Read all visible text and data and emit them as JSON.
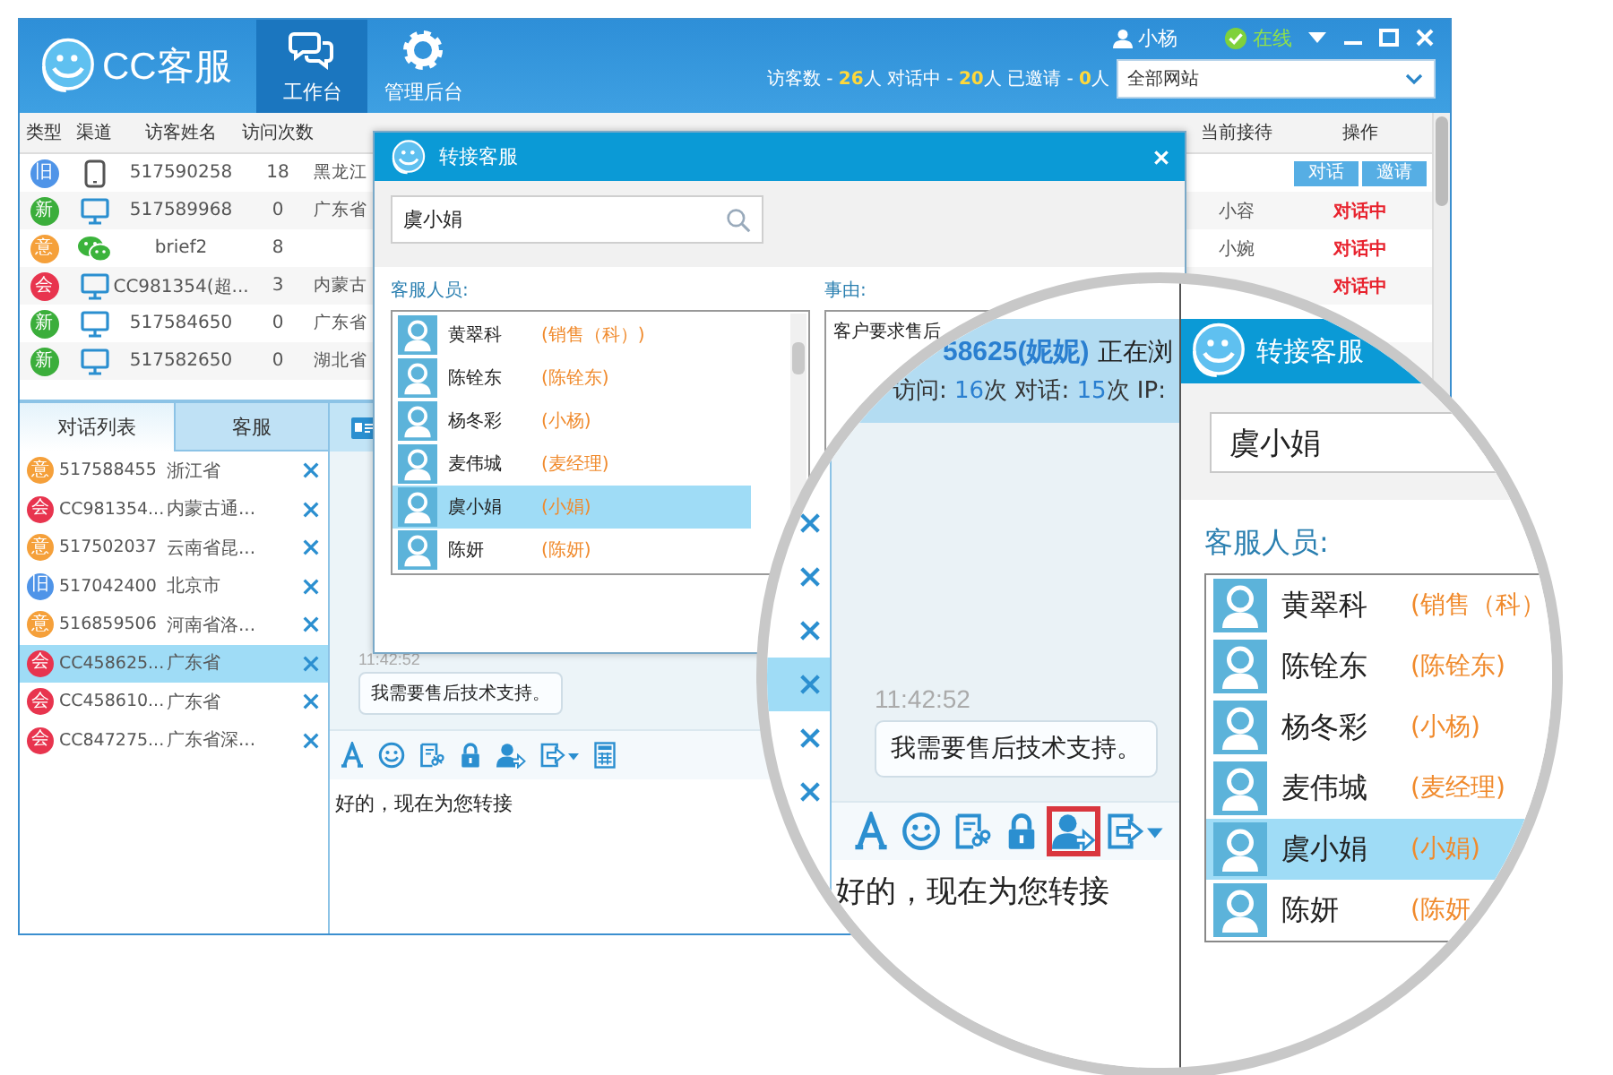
{
  "window": {
    "logo_text": "CC客服",
    "nav": [
      {
        "label": "工作台",
        "selected": true
      },
      {
        "label": "管理后台",
        "selected": false
      }
    ],
    "user": "小杨",
    "status": "在线",
    "stats": [
      {
        "label": "访客数 -",
        "value": "26",
        "unit": "人"
      },
      {
        "label": "对话中 -",
        "value": "20",
        "unit": "人"
      },
      {
        "label": "已邀请 -",
        "value": "0",
        "unit": "人"
      }
    ],
    "site_select": "全部网站"
  },
  "visitor_table": {
    "columns_left": [
      "类型",
      "渠道",
      "访客姓名",
      "访问次数"
    ],
    "columns_right": [
      "当前接待",
      "操作"
    ],
    "rows": [
      {
        "type": "旧",
        "color": "#4f94e8",
        "kind": "mobile",
        "name": "517590258",
        "visits": "18",
        "region": "黑龙江",
        "actions": [
          "对话",
          "邀请"
        ]
      },
      {
        "type": "新",
        "color": "#3bae3b",
        "kind": "desktop",
        "name": "517589968",
        "visits": "0",
        "region": "广东省",
        "receptionist": "小容",
        "status": "对话中"
      },
      {
        "type": "意",
        "color": "#f5a03a",
        "kind": "wechat",
        "name": "brief2",
        "visits": "8",
        "receptionist": "小婉",
        "status": "对话中"
      },
      {
        "type": "会",
        "color": "#e8344e",
        "kind": "desktop",
        "name": "CC981354(超...",
        "visits": "3",
        "region": "内蒙古",
        "status": "对话中"
      },
      {
        "type": "新",
        "color": "#3bae3b",
        "kind": "desktop",
        "name": "517584650",
        "visits": "0",
        "region": "广东省"
      },
      {
        "type": "新",
        "color": "#3bae3b",
        "kind": "desktop",
        "name": "517582650",
        "visits": "0",
        "region": "湖北省"
      }
    ]
  },
  "conversation_tabs": [
    {
      "label": "对话列表",
      "selected": true
    },
    {
      "label": "客服",
      "selected": false
    }
  ],
  "conversations": [
    {
      "type": "意",
      "color": "#f5a03a",
      "id": "517588455",
      "region": "浙江省",
      "selected": false
    },
    {
      "type": "会",
      "color": "#e8344e",
      "id": "CC981354...",
      "region": "内蒙古通...",
      "selected": false
    },
    {
      "type": "意",
      "color": "#f5a03a",
      "id": "517502037",
      "region": "云南省昆...",
      "selected": false
    },
    {
      "type": "旧",
      "color": "#4f94e8",
      "id": "517042400",
      "region": "北京市",
      "selected": false
    },
    {
      "type": "意",
      "color": "#f5a03a",
      "id": "516859506",
      "region": "河南省洛...",
      "selected": false
    },
    {
      "type": "会",
      "color": "#e8344e",
      "id": "CC458625...",
      "region": "广东省",
      "selected": true
    },
    {
      "type": "会",
      "color": "#e8344e",
      "id": "CC458610...",
      "region": "广东省",
      "selected": false
    },
    {
      "type": "会",
      "color": "#e8344e",
      "id": "CC847275...",
      "region": "广东省深...",
      "selected": false
    }
  ],
  "chat": {
    "timestamp": "11:42:52",
    "message": "我需要售后技术支持。",
    "input": "好的，现在为您转接"
  },
  "transfer_dialog": {
    "title": "转接客服",
    "search": "虞小娟",
    "agents_label": "客服人员:",
    "agents": [
      {
        "name": "黄翠科",
        "nickname": "(销售（科）)",
        "selected": false
      },
      {
        "name": "陈铨东",
        "nickname": "(陈铨东)",
        "selected": false
      },
      {
        "name": "杨冬彩",
        "nickname": "(小杨)",
        "selected": false
      },
      {
        "name": "麦伟城",
        "nickname": "(麦经理)",
        "selected": false
      },
      {
        "name": "虞小娟",
        "nickname": "(小娟)",
        "selected": true
      },
      {
        "name": "陈妍",
        "nickname": "(陈妍)",
        "selected": false
      }
    ],
    "reason_label": "事由:",
    "reason": "客户要求售后"
  },
  "magnifier": {
    "conversation_rows": [
      {
        "selected": false
      },
      {
        "selected": false
      },
      {
        "selected": false
      },
      {
        "selected": true
      },
      {
        "selected": false
      },
      {
        "selected": false
      }
    ],
    "visitor": "58625(妮妮)",
    "browsing": "正在浏",
    "stats": [
      {
        "label": "访问:",
        "value": "16",
        "unit": "次"
      },
      {
        "label": "对话:",
        "value": "15",
        "unit": "次"
      },
      {
        "label": "IP:"
      }
    ],
    "timestamp": "11:42:52",
    "message": "我需要售后技术支持。",
    "toolbar": [
      {
        "highlighted": false
      },
      {
        "highlighted": false
      },
      {
        "highlighted": false
      },
      {
        "highlighted": false
      },
      {
        "highlighted": true
      },
      {
        "highlighted": false
      }
    ],
    "input": "好的，现在为您转接",
    "dialog": {
      "title": "转接客服",
      "search": "虞小娟",
      "agents_label": "客服人员:",
      "agents": [
        {
          "name": "黄翠科",
          "nickname": "(销售（科）",
          "selected": false
        },
        {
          "name": "陈铨东",
          "nickname": "(陈铨东)",
          "selected": false
        },
        {
          "name": "杨冬彩",
          "nickname": "(小杨)",
          "selected": false
        },
        {
          "name": "麦伟城",
          "nickname": "(麦经理)",
          "selected": false
        },
        {
          "name": "虞小娟",
          "nickname": "(小娟)",
          "selected": true
        },
        {
          "name": "陈妍",
          "nickname": "(陈妍",
          "selected": false
        }
      ]
    }
  }
}
